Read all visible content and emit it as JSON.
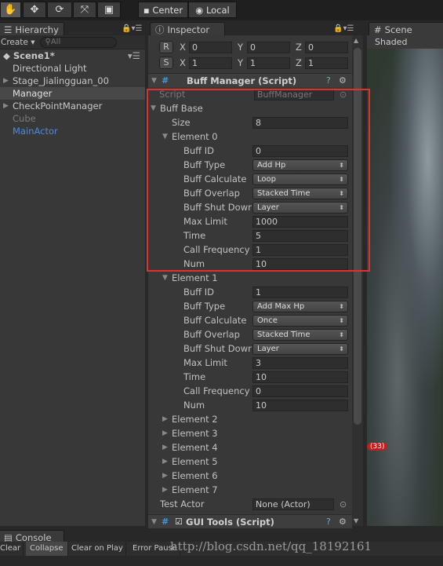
{
  "toolbar": {
    "tools": [
      "hand-icon",
      "move-icon",
      "rotate-icon",
      "scale-icon",
      "rect-icon"
    ],
    "pivot": "Center",
    "space": "Local"
  },
  "hierarchy": {
    "tab": "Hierarchy",
    "create": "Create ▾",
    "search_placeholder": "All",
    "scene": "Scene1*",
    "items": [
      {
        "label": "Directional Light",
        "arrow": false,
        "color": "#c8c8c8"
      },
      {
        "label": "Stage_Jialingguan_00",
        "arrow": true,
        "color": "#c8c8c8"
      },
      {
        "label": "Manager",
        "arrow": false,
        "color": "#e0e0e0",
        "selected": true
      },
      {
        "label": "CheckPointManager",
        "arrow": true,
        "color": "#c8c8c8"
      },
      {
        "label": "Cube",
        "arrow": false,
        "color": "#7a7a7a"
      },
      {
        "label": "MainActor",
        "arrow": false,
        "color": "#4d8ae0"
      }
    ]
  },
  "inspector": {
    "tab": "Inspector",
    "transform": {
      "r": {
        "btn": "R",
        "x": "0",
        "y": "0",
        "z": "0"
      },
      "s": {
        "btn": "S",
        "x": "1",
        "y": "1",
        "z": "1"
      }
    },
    "component": "Buff Manager (Script)",
    "script_label": "Script",
    "script_value": "BuffManager",
    "list_label": "Buff Base",
    "size_label": "Size",
    "size": "8",
    "elements": [
      {
        "label": "Element 0",
        "expanded": true,
        "fields": [
          [
            "Buff ID",
            "0",
            "field"
          ],
          [
            "Buff Type",
            "Add Hp",
            "drop"
          ],
          [
            "Buff Calculate",
            "Loop",
            "drop"
          ],
          [
            "Buff Overlap",
            "Stacked Time",
            "drop"
          ],
          [
            "Buff Shut Dowr",
            "Layer",
            "drop"
          ],
          [
            "Max Limit",
            "1000",
            "field"
          ],
          [
            "Time",
            "5",
            "field"
          ],
          [
            "Call Frequency",
            "1",
            "field"
          ],
          [
            "Num",
            "10",
            "field"
          ]
        ]
      },
      {
        "label": "Element 1",
        "expanded": true,
        "fields": [
          [
            "Buff ID",
            "1",
            "field"
          ],
          [
            "Buff Type",
            "Add Max Hp",
            "drop"
          ],
          [
            "Buff Calculate",
            "Once",
            "drop"
          ],
          [
            "Buff Overlap",
            "Stacked Time",
            "drop"
          ],
          [
            "Buff Shut Dowr",
            "Layer",
            "drop"
          ],
          [
            "Max Limit",
            "3",
            "field"
          ],
          [
            "Time",
            "10",
            "field"
          ],
          [
            "Call Frequency",
            "0",
            "field"
          ],
          [
            "Num",
            "10",
            "field"
          ]
        ]
      },
      {
        "label": "Element 2"
      },
      {
        "label": "Element 3"
      },
      {
        "label": "Element 4"
      },
      {
        "label": "Element 5"
      },
      {
        "label": "Element 6"
      },
      {
        "label": "Element 7"
      }
    ],
    "test_actor_label": "Test Actor",
    "test_actor_value": "None (Actor)",
    "component2": "GUI Tools (Script)"
  },
  "scene": {
    "tab": "Scene",
    "mode": "Shaded",
    "badge": "(33)"
  },
  "console": {
    "tab": "Console",
    "buttons": [
      "Clear",
      "Collapse",
      "Clear on Play",
      "Error Pause"
    ],
    "watermark": "http://blog.csdn.net/qq_18192161"
  },
  "highlight_color": "#e03030"
}
